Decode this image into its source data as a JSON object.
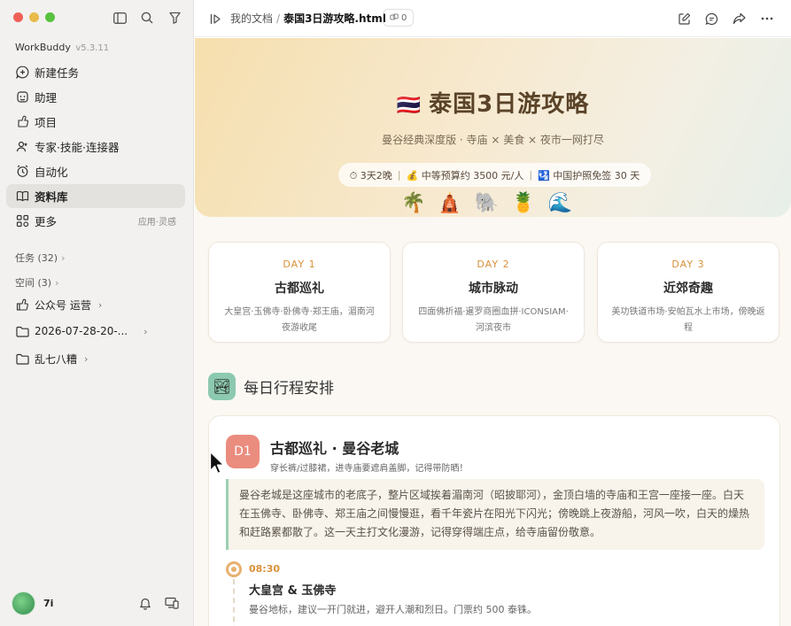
{
  "sidebar": {
    "app_name": "WorkBuddy",
    "version": "v5.3.11",
    "items": [
      {
        "label": "新建任务",
        "icon": "new-task-icon"
      },
      {
        "label": "助理",
        "icon": "assistant-icon"
      },
      {
        "label": "项目",
        "icon": "project-icon"
      },
      {
        "label": "专家·技能·连接器",
        "icon": "expert-icon"
      },
      {
        "label": "自动化",
        "icon": "automation-icon"
      },
      {
        "label": "资料库",
        "icon": "library-icon",
        "active": true
      },
      {
        "label": "更多",
        "icon": "more-grid-icon",
        "extra": "应用·灵感"
      }
    ],
    "tasks_label": "任务 (32)",
    "spaces_label": "空间 (3)",
    "spaces": [
      {
        "label": "公众号 运营",
        "icon": "connector-icon"
      },
      {
        "label": "2026-07-28-20-...",
        "icon": "folder-icon"
      },
      {
        "label": "乱七八糟",
        "icon": "folder-icon"
      }
    ],
    "user": "7i"
  },
  "topbar": {
    "breadcrumb_parent": "我的文档",
    "breadcrumb_sep": "/",
    "breadcrumb_current": "泰国3日游攻略.html",
    "badge_count": "0"
  },
  "hero": {
    "flag": "🇹🇭",
    "title": "泰国3日游攻略",
    "subtitle": "曼谷经典深度版 · 寺庙 × 美食 × 夜市一网打尽",
    "pill_duration": "⏱ 3天2晚",
    "pill_budget": "💰 中等预算约 3500 元/人",
    "pill_visa": "🛂 中国护照免签 30 天",
    "icons": "🌴🛕🐘🍍🌊"
  },
  "days": [
    {
      "num": "DAY 1",
      "title": "古都巡礼",
      "desc": "大皇宫·玉佛寺·卧佛寺·郑王庙，湄南河夜游收尾"
    },
    {
      "num": "DAY 2",
      "title": "城市脉动",
      "desc": "四面佛祈福·暹罗商圈血拼·ICONSIAM·河滨夜市"
    },
    {
      "num": "DAY 3",
      "title": "近郊奇趣",
      "desc": "美功铁道市场·安帕瓦水上市场，傍晚返程"
    }
  ],
  "schedule": {
    "section_icon": "🏞",
    "section_title": "每日行程安排",
    "day_badge": "D1",
    "day_title": "古都巡礼 · 曼谷老城",
    "day_note": "穿长裤/过膝裙，进寺庙要遮肩盖脚，记得带防晒！",
    "day_intro": "曼谷老城是这座城市的老底子，整片区域挨着湄南河（昭披耶河），金顶白墙的寺庙和王宫一座接一座。白天在玉佛寺、卧佛寺、郑王庙之间慢慢逛，看千年瓷片在阳光下闪光；傍晚跳上夜游船，河风一吹，白天的燥热和赶路累都散了。这一天主打文化漫游，记得穿得端庄点，给寺庙留份敬意。",
    "timeline": [
      {
        "time": "08:30",
        "title": "大皇宫 & 玉佛寺",
        "desc": "曼谷地标，建议一开门就进，避开人潮和烈日。门票约 500 泰铢。"
      }
    ]
  },
  "colors": {
    "accent": "#d8913a",
    "hero_start": "#f6dfae",
    "teal": "#8cc9b0",
    "d1": "#ea8c7e"
  }
}
